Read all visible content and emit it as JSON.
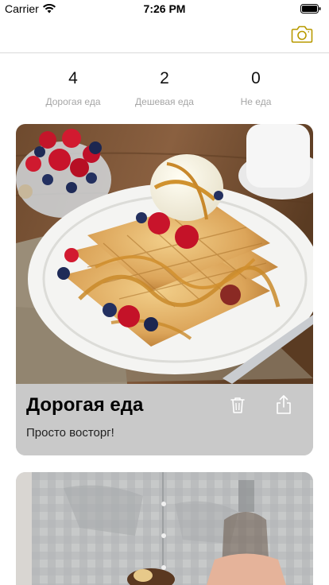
{
  "status_bar": {
    "carrier": "Carrier",
    "time": "7:26 PM",
    "wifi_icon": "wifi-icon",
    "battery_icon": "battery-icon"
  },
  "nav_bar": {
    "camera_icon": "camera-icon",
    "accent_color": "#b89a00"
  },
  "stats": [
    {
      "count": "4",
      "label": "Дорогая еда"
    },
    {
      "count": "2",
      "label": "Дешевая еда"
    },
    {
      "count": "0",
      "label": "Не еда"
    }
  ],
  "cards": [
    {
      "title": "Дорогая еда",
      "subtitle": "Просто восторг!",
      "image": "waffles-with-ice-cream-and-berries",
      "trash_icon": "trash-icon",
      "share_icon": "share-icon"
    },
    {
      "image": "person-in-checkered-shirt-holding-bottle"
    }
  ],
  "colors": {
    "card_background": "#c9c9c9",
    "stat_label": "#a6a6a6",
    "separator": "#d9d9d9"
  }
}
